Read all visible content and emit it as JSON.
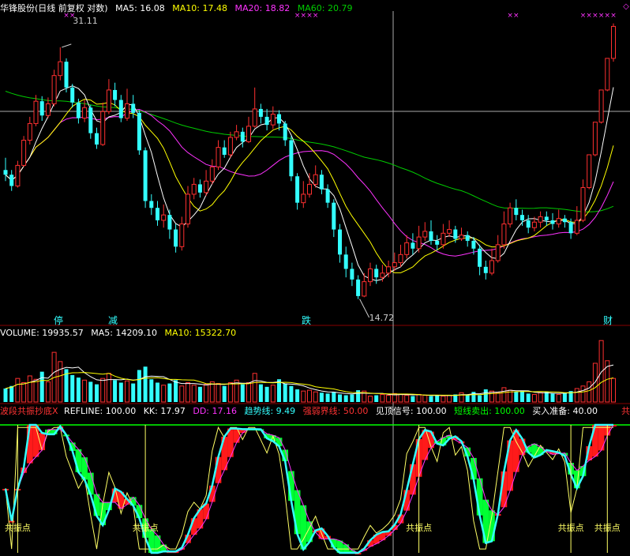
{
  "price_panel": {
    "stock_title": "华锋股份(日线 前复权 对数)",
    "indicators": [
      {
        "label": "MA5: 16.08",
        "color": "#ffffff"
      },
      {
        "label": "MA10: 17.48",
        "color": "#ffff00"
      },
      {
        "label": "MA20: 18.82",
        "color": "#ff33ff"
      },
      {
        "label": "MA60: 20.79",
        "color": "#00cc00"
      }
    ],
    "high_label": "31.11",
    "low_label": "14.72",
    "event_labels": [
      "停",
      "减",
      "跌",
      "财"
    ]
  },
  "volume_panel": {
    "indicators": [
      {
        "label": "VOLUME: 19935.57",
        "color": "#ffffff"
      },
      {
        "label": "MA5: 14209.10",
        "color": "#ffffff"
      },
      {
        "label": "MA10: 15322.70",
        "color": "#ffff00"
      }
    ]
  },
  "indicator_panel": {
    "indicators": [
      {
        "label": "波段共振抄底X",
        "color": "#ff3333"
      },
      {
        "label": "REFLINE: 100.00",
        "color": "#ffffff"
      },
      {
        "label": "KK: 17.97",
        "color": "#ffffff"
      },
      {
        "label": "DD: 17.16",
        "color": "#ff33ff"
      },
      {
        "label": "趋势线: 9.49",
        "color": "#33ffff"
      },
      {
        "label": "强弱界线: 50.00",
        "color": "#ff3333"
      },
      {
        "label": "见顶信号: 100.00",
        "color": "#ffffff"
      },
      {
        "label": "短线卖出: 100.00",
        "color": "#00ff00"
      },
      {
        "label": "买入准备: 40.00",
        "color": "#ffffff"
      },
      {
        "label": "共",
        "color": "#ff3333"
      }
    ],
    "signal_label": "共振点"
  },
  "chart_data": {
    "type": "candlestick",
    "colors": {
      "up": "#ff3030",
      "down": "#33ffff",
      "ma5": "#ffffff",
      "ma10": "#ffff00",
      "ma20": "#ff33ff",
      "ma60": "#00cc00"
    },
    "candles": [
      [
        21.6,
        21.3,
        22.4,
        20.9
      ],
      [
        21.3,
        20.6,
        21.6,
        20.3
      ],
      [
        20.6,
        21.9,
        22.2,
        20.5
      ],
      [
        21.9,
        23.6,
        23.9,
        21.8
      ],
      [
        23.6,
        24.8,
        25.3,
        23.3
      ],
      [
        24.8,
        26.5,
        27.0,
        24.6
      ],
      [
        26.5,
        25.4,
        26.9,
        25.0
      ],
      [
        25.4,
        26.3,
        26.8,
        25.2
      ],
      [
        26.3,
        28.6,
        29.1,
        26.1
      ],
      [
        28.6,
        29.8,
        31.11,
        28.2
      ],
      [
        29.8,
        27.6,
        30.1,
        27.2
      ],
      [
        27.6,
        26.4,
        27.9,
        26.0
      ],
      [
        26.4,
        25.2,
        26.7,
        24.8
      ],
      [
        25.2,
        26.0,
        26.6,
        24.9
      ],
      [
        26.0,
        24.1,
        26.2,
        23.7
      ],
      [
        24.1,
        23.3,
        24.5,
        23.0
      ],
      [
        23.3,
        25.7,
        26.4,
        23.2
      ],
      [
        25.7,
        27.4,
        28.3,
        25.5
      ],
      [
        27.4,
        26.6,
        28.0,
        26.1
      ],
      [
        26.6,
        25.2,
        27.0,
        24.9
      ],
      [
        25.2,
        26.3,
        27.5,
        25.0
      ],
      [
        26.3,
        25.6,
        27.0,
        25.2
      ],
      [
        25.6,
        22.9,
        25.8,
        22.6
      ],
      [
        22.9,
        19.7,
        23.1,
        19.3
      ],
      [
        19.7,
        19.3,
        20.1,
        18.9
      ],
      [
        19.3,
        18.6,
        19.7,
        18.3
      ],
      [
        18.6,
        18.9,
        19.5,
        18.2
      ],
      [
        18.9,
        18.1,
        19.2,
        17.6
      ],
      [
        18.1,
        17.2,
        18.4,
        16.9
      ],
      [
        17.2,
        18.4,
        18.8,
        17.0
      ],
      [
        18.4,
        20.1,
        20.6,
        18.2
      ],
      [
        20.1,
        20.7,
        21.1,
        19.8
      ],
      [
        20.7,
        20.2,
        21.0,
        19.9
      ],
      [
        20.2,
        20.9,
        21.6,
        20.0
      ],
      [
        20.9,
        21.8,
        22.3,
        20.7
      ],
      [
        21.8,
        23.1,
        23.6,
        21.6
      ],
      [
        23.1,
        22.6,
        23.6,
        22.4
      ],
      [
        22.6,
        23.8,
        24.2,
        22.4
      ],
      [
        23.8,
        24.2,
        24.7,
        23.6
      ],
      [
        24.2,
        23.5,
        24.5,
        23.1
      ],
      [
        23.5,
        24.6,
        25.3,
        23.4
      ],
      [
        24.6,
        25.9,
        27.6,
        24.5
      ],
      [
        25.9,
        25.3,
        26.3,
        24.8
      ],
      [
        25.3,
        24.7,
        25.9,
        24.3
      ],
      [
        24.7,
        25.5,
        26.1,
        24.4
      ],
      [
        25.5,
        24.8,
        25.8,
        24.3
      ],
      [
        24.8,
        23.6,
        25.0,
        23.2
      ],
      [
        23.6,
        21.2,
        23.9,
        20.9
      ],
      [
        21.2,
        19.6,
        21.4,
        19.2
      ],
      [
        19.6,
        20.1,
        20.9,
        19.3
      ],
      [
        20.1,
        20.7,
        21.4,
        19.9
      ],
      [
        20.7,
        21.3,
        21.9,
        20.5
      ],
      [
        21.3,
        20.4,
        21.6,
        20.1
      ],
      [
        20.4,
        19.6,
        20.7,
        19.3
      ],
      [
        19.6,
        18.1,
        19.8,
        17.7
      ],
      [
        18.1,
        16.8,
        18.4,
        16.4
      ],
      [
        16.8,
        16.1,
        17.2,
        15.7
      ],
      [
        16.1,
        15.6,
        16.4,
        15.3
      ],
      [
        15.6,
        14.85,
        15.8,
        14.72
      ],
      [
        14.85,
        15.5,
        15.9,
        14.8
      ],
      [
        15.5,
        16.1,
        16.4,
        15.3
      ],
      [
        16.1,
        15.7,
        16.3,
        15.4
      ],
      [
        15.7,
        15.9,
        16.3,
        15.5
      ],
      [
        15.9,
        16.2,
        16.5,
        15.7
      ],
      [
        16.2,
        16.4,
        16.9,
        16.0
      ],
      [
        16.4,
        16.8,
        17.3,
        16.2
      ],
      [
        16.8,
        17.4,
        17.8,
        16.6
      ],
      [
        17.4,
        17.1,
        17.9,
        16.8
      ],
      [
        17.1,
        17.7,
        18.3,
        16.9
      ],
      [
        17.7,
        18.0,
        18.5,
        17.5
      ],
      [
        18.0,
        17.5,
        18.6,
        17.3
      ],
      [
        17.5,
        17.3,
        17.8,
        17.0
      ],
      [
        17.3,
        17.9,
        18.4,
        17.1
      ],
      [
        17.9,
        18.1,
        18.6,
        17.7
      ],
      [
        18.1,
        17.6,
        18.3,
        17.4
      ],
      [
        17.6,
        17.8,
        18.2,
        17.5
      ],
      [
        17.8,
        17.5,
        18.0,
        17.2
      ],
      [
        17.5,
        17.1,
        17.7,
        16.8
      ],
      [
        17.1,
        16.2,
        17.3,
        15.8
      ],
      [
        16.2,
        15.9,
        16.5,
        15.6
      ],
      [
        15.9,
        16.5,
        17.1,
        15.8
      ],
      [
        16.5,
        17.3,
        17.8,
        16.4
      ],
      [
        17.3,
        18.4,
        19.1,
        17.1
      ],
      [
        18.4,
        19.3,
        19.6,
        18.2
      ],
      [
        19.3,
        18.9,
        19.8,
        18.6
      ],
      [
        18.9,
        18.6,
        19.2,
        18.3
      ],
      [
        18.6,
        18.2,
        18.9,
        17.9
      ],
      [
        18.2,
        18.5,
        18.8,
        18.0
      ],
      [
        18.5,
        18.8,
        19.1,
        18.2
      ],
      [
        18.8,
        18.6,
        19.1,
        18.3
      ],
      [
        18.6,
        18.4,
        19.0,
        18.1
      ],
      [
        18.4,
        18.7,
        19.2,
        18.2
      ],
      [
        18.7,
        18.5,
        18.9,
        18.2
      ],
      [
        18.5,
        17.9,
        18.7,
        17.6
      ],
      [
        17.9,
        18.6,
        19.4,
        17.8
      ],
      [
        18.6,
        20.5,
        21.0,
        18.5
      ],
      [
        20.5,
        22.6,
        22.6,
        20.4
      ],
      [
        22.6,
        24.9,
        24.9,
        22.5
      ],
      [
        24.9,
        27.4,
        27.4,
        24.8
      ],
      [
        27.4,
        30.1,
        30.1,
        27.3
      ],
      [
        30.1,
        33.1,
        33.4,
        29.8
      ]
    ],
    "volume": [
      1.6,
      1.9,
      2.8,
      2.3,
      3.1,
      2.7,
      3.6,
      2.4,
      5.9,
      4.8,
      3.9,
      3.2,
      2.9,
      2.6,
      2.4,
      2.1,
      2.8,
      3.4,
      2.6,
      2.3,
      2.5,
      2.2,
      3.8,
      4.2,
      2.7,
      2.3,
      2.0,
      2.2,
      2.6,
      1.9,
      2.3,
      2.0,
      1.8,
      2.1,
      2.4,
      2.2,
      1.9,
      2.3,
      2.6,
      2.1,
      2.3,
      3.4,
      2.1,
      1.8,
      2.0,
      2.7,
      2.2,
      1.9,
      1.5,
      1.3,
      1.4,
      1.2,
      1.1,
      1.0,
      1.2,
      0.9,
      0.8,
      0.9,
      1.4,
      1.3,
      0.7,
      0.8,
      0.9,
      0.8,
      1.0,
      0.9,
      0.8,
      0.7,
      0.9,
      0.8,
      0.7,
      0.8,
      0.7,
      0.8,
      0.9,
      1.1,
      0.9,
      1.2,
      0.8,
      1.5,
      1.3,
      1.1,
      1.7,
      1.4,
      1.2,
      1.3,
      1.0,
      0.9,
      1.1,
      1.2,
      1.0,
      0.9,
      1.1,
      1.3,
      1.6,
      1.9,
      2.4,
      4.6,
      7.3,
      4.9,
      2.8
    ],
    "signals": [
      2,
      23,
      68,
      93,
      99
    ],
    "ylim_log": [
      14.0,
      34.0
    ]
  }
}
